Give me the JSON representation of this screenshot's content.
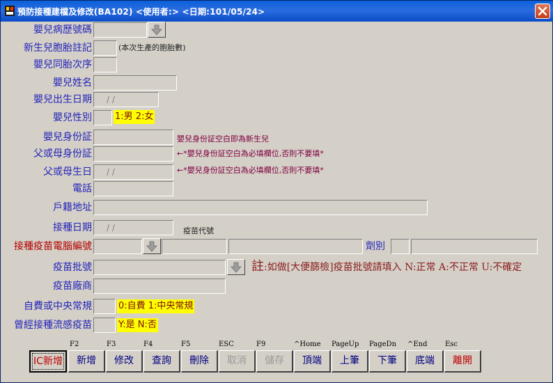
{
  "window": {
    "title": "預防接種建檔及修改(BA102)   <使用者:>   <日期:101/05/24>"
  },
  "labels": {
    "record_no": "嬰兒病歷號碼",
    "multiple_birth": "新生兒胞胎註記",
    "birth_order": "嬰兒同胎次序",
    "name": "嬰兒姓名",
    "birth_date": "嬰兒出生日期",
    "gender": "嬰兒性別",
    "id": "嬰兒身份証",
    "parent_id": "父或母身份証",
    "parent_birth": "父或母生日",
    "phone": "電話",
    "address": "戶籍地址",
    "vacc_date": "接種日期",
    "vaccine_code": "接種疫苗電腦編號",
    "dose": "劑別",
    "batch": "疫苗批號",
    "maker": "疫苗廠商",
    "payment": "自費或中央常規",
    "flu": "曾經接種流感疫苗"
  },
  "fields": {
    "birth_date_value": "/ /",
    "parent_birth_value": "/ /",
    "vacc_date_value": "/ /"
  },
  "hints": {
    "multiple_birth": "(本次生產的胞胎數)",
    "gender": "1:男 2:女",
    "id": "嬰兒身份証空白即為新生兒",
    "parent_id": "←*嬰兒身份証空白為必填欄位,否則不要填*",
    "parent_birth": "←*嬰兒身份証空白為必填欄位,否則不要填*",
    "vaccine_code_header": "疫苗代號",
    "batch_note_prefix": "註",
    "batch_note": ":如做[大便篩檢]疫苗批號請填入 N:正常 A:不正常 U:不確定",
    "payment": "0:自費 1:中央常規",
    "flu": "Y:是  N:否"
  },
  "toolbar": {
    "buttons": [
      {
        "key": "",
        "label": "IC新增"
      },
      {
        "key": "F2",
        "label": "新增"
      },
      {
        "key": "F3",
        "label": "修改"
      },
      {
        "key": "F4",
        "label": "查詢"
      },
      {
        "key": "F5",
        "label": "刪除"
      },
      {
        "key": "ESC",
        "label": "取消"
      },
      {
        "key": "F9",
        "label": "儲存"
      },
      {
        "key": "^Home",
        "label": "頂端"
      },
      {
        "key": "PageUp",
        "label": "上筆"
      },
      {
        "key": "PageDn",
        "label": "下筆"
      },
      {
        "key": "^End",
        "label": "底端"
      },
      {
        "key": "Esc",
        "label": "離開"
      }
    ]
  },
  "colors": {
    "label": "#2424b8",
    "label_required": "#b40000",
    "highlight": "#ffff00",
    "hint": "#800040"
  }
}
